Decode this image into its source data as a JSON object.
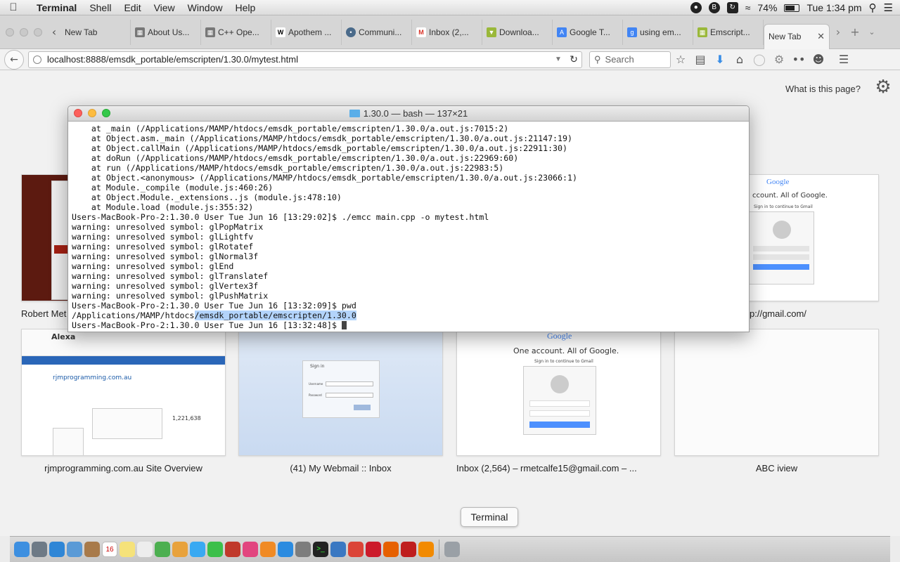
{
  "menubar": {
    "app_name": "Terminal",
    "menus": [
      "Shell",
      "Edit",
      "View",
      "Window",
      "Help"
    ],
    "battery": "74%",
    "battery_level": 0.74,
    "clock": "Tue 1:34 pm"
  },
  "browser": {
    "tabs": [
      {
        "label": "New Tab",
        "icon": "blank-icon"
      },
      {
        "label": "About Us...",
        "icon": "page-icon"
      },
      {
        "label": "C++ Ope...",
        "icon": "page-icon"
      },
      {
        "label": "Apothem ...",
        "icon": "wikipedia-icon"
      },
      {
        "label": "Communi...",
        "icon": "forum-icon"
      },
      {
        "label": "Inbox (2,...",
        "icon": "gmail-icon"
      },
      {
        "label": "Downloa...",
        "icon": "download-icon"
      },
      {
        "label": "Google T...",
        "icon": "translate-icon"
      },
      {
        "label": "using em...",
        "icon": "google-icon"
      },
      {
        "label": "Emscript...",
        "icon": "page-icon"
      }
    ],
    "active_tab": "New Tab",
    "url": "localhost:8888/emsdk_portable/emscripten/1.30.0/mytest.html",
    "search_placeholder": "Search"
  },
  "newtab": {
    "what_is": "What is this page?",
    "tiles_top": [
      {
        "title": "Robert Met"
      },
      {
        "title": "p://gmail.com/"
      }
    ],
    "tiles_bottom": [
      {
        "title": "rjmprogramming.com.au Site Overview"
      },
      {
        "title": "(41) My Webmail :: Inbox"
      },
      {
        "title": "Inbox (2,564) – rmetcalfe15@gmail.com – ..."
      },
      {
        "title": "ABC iview"
      }
    ],
    "thumb_text": {
      "alexa": "Alexa",
      "alexa_site": "rjmprogramming.com.au",
      "alexa_rank": "1,221,638",
      "google_logo": "Google",
      "google_tagline": "One account. All of Google.",
      "google_tagline_partial": "ccount. All of Google.",
      "gmail_sub": "Sign in to continue to Gmail",
      "sign_in": "Sign in",
      "username": "Username",
      "password": "Password"
    }
  },
  "terminal": {
    "title": "1.30.0 — bash — 137×21",
    "lines": [
      "    at _main (/Applications/MAMP/htdocs/emsdk_portable/emscripten/1.30.0/a.out.js:7015:2)",
      "    at Object.asm._main (/Applications/MAMP/htdocs/emsdk_portable/emscripten/1.30.0/a.out.js:21147:19)",
      "    at Object.callMain (/Applications/MAMP/htdocs/emsdk_portable/emscripten/1.30.0/a.out.js:22911:30)",
      "    at doRun (/Applications/MAMP/htdocs/emsdk_portable/emscripten/1.30.0/a.out.js:22969:60)",
      "    at run (/Applications/MAMP/htdocs/emsdk_portable/emscripten/1.30.0/a.out.js:22983:5)",
      "    at Object.<anonymous> (/Applications/MAMP/htdocs/emsdk_portable/emscripten/1.30.0/a.out.js:23066:1)",
      "    at Module._compile (module.js:460:26)",
      "    at Object.Module._extensions..js (module.js:478:10)",
      "    at Module.load (module.js:355:32)",
      "Users-MacBook-Pro-2:1.30.0 User Tue Jun 16 [13:29:02]$ ./emcc main.cpp -o mytest.html",
      "warning: unresolved symbol: glPopMatrix",
      "warning: unresolved symbol: glLightfv",
      "warning: unresolved symbol: glRotatef",
      "warning: unresolved symbol: glNormal3f",
      "warning: unresolved symbol: glEnd",
      "warning: unresolved symbol: glTranslatef",
      "warning: unresolved symbol: glVertex3f",
      "warning: unresolved symbol: glPushMatrix",
      "Users-MacBook-Pro-2:1.30.0 User Tue Jun 16 [13:32:09]$ pwd"
    ],
    "pwd_prefix": "/Applications/MAMP/htdocs",
    "pwd_selected": "/emsdk_portable/emscripten/1.30.0",
    "prompt": "Users-MacBook-Pro-2:1.30.0 User Tue Jun 16 [13:32:48]$ "
  },
  "dock": {
    "tooltip": "Terminal",
    "calendar_day": "16",
    "icons": [
      {
        "name": "finder-icon",
        "color": "#3d8fe0"
      },
      {
        "name": "launchpad-icon",
        "color": "#6e7a86"
      },
      {
        "name": "safari-icon",
        "color": "#2f86d6"
      },
      {
        "name": "mail-icon",
        "color": "#5a9ad6"
      },
      {
        "name": "contacts-icon",
        "color": "#a87a4a"
      },
      {
        "name": "calendar-icon",
        "color": "#ffffff"
      },
      {
        "name": "notes-icon",
        "color": "#f5e27a"
      },
      {
        "name": "reminders-icon",
        "color": "#ededed"
      },
      {
        "name": "maps-icon",
        "color": "#4caf50"
      },
      {
        "name": "photos-icon",
        "color": "#e8a23c"
      },
      {
        "name": "messages-icon",
        "color": "#39a9f2"
      },
      {
        "name": "facetime-icon",
        "color": "#3cbf4a"
      },
      {
        "name": "photobooth-icon",
        "color": "#c0392b"
      },
      {
        "name": "itunes-icon",
        "color": "#e2457f"
      },
      {
        "name": "ibooks-icon",
        "color": "#f08a24"
      },
      {
        "name": "appstore-icon",
        "color": "#2b8be0"
      },
      {
        "name": "system-preferences-icon",
        "color": "#7d7d7d"
      },
      {
        "name": "terminal-icon",
        "color": "#222222"
      },
      {
        "name": "xcode-icon",
        "color": "#3a78c2"
      },
      {
        "name": "chrome-icon",
        "color": "#db4437"
      },
      {
        "name": "opera-icon",
        "color": "#cc1b2b"
      },
      {
        "name": "firefox-icon",
        "color": "#e66000"
      },
      {
        "name": "filezilla-icon",
        "color": "#bf1e1e"
      },
      {
        "name": "vlc-icon",
        "color": "#f28a00"
      },
      {
        "name": "trash-icon",
        "color": "#9aa0a6"
      }
    ]
  }
}
